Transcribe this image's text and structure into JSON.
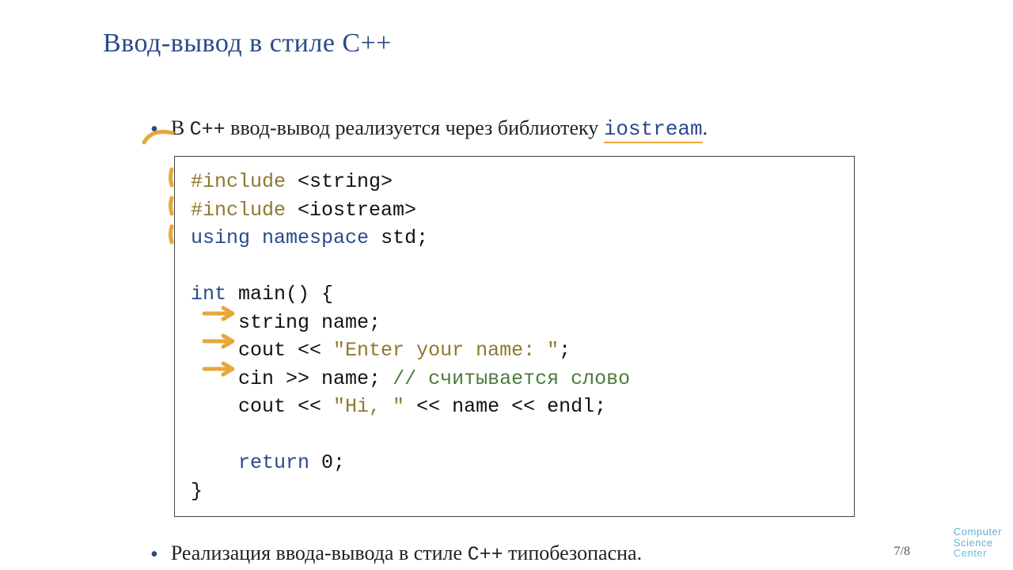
{
  "title": "Ввод-вывод в стиле C++",
  "bullets": {
    "b1_pre": "В ",
    "b1_lang": "C++",
    "b1_mid": " ввод-вывод реализуется через библиотеку ",
    "b1_lib": "iostream",
    "b1_post": ".",
    "b2_pre": "Реализация ввода-вывода в стиле ",
    "b2_lang": "C++",
    "b2_post": " типобезопасна."
  },
  "code": {
    "l1": {
      "pre": "#include",
      "rest": " <string>"
    },
    "l2": {
      "pre": "#include",
      "rest": " <iostream>"
    },
    "l3": {
      "kw1": "using",
      "kw2": "namespace",
      "rest": " std;"
    },
    "l5": {
      "kw": "int",
      "rest": " main() {"
    },
    "l6": {
      "indent": "    ",
      "t": "string name;"
    },
    "l7": {
      "indent": "    ",
      "a": "cout << ",
      "s": "\"Enter your name: \"",
      "b": ";"
    },
    "l8": {
      "indent": "    ",
      "a": "cin >> name; ",
      "c": "// считывается слово"
    },
    "l9": {
      "indent": "    ",
      "a": "cout << ",
      "s": "\"Hi, \"",
      "b": " << name << endl;"
    },
    "l11": {
      "indent": "    ",
      "kw": "return",
      "rest": " 0;"
    },
    "l12": {
      "t": "}"
    }
  },
  "page": "7/8",
  "logo": {
    "l1": "Computer",
    "l2": "Science",
    "l3": "Center"
  }
}
